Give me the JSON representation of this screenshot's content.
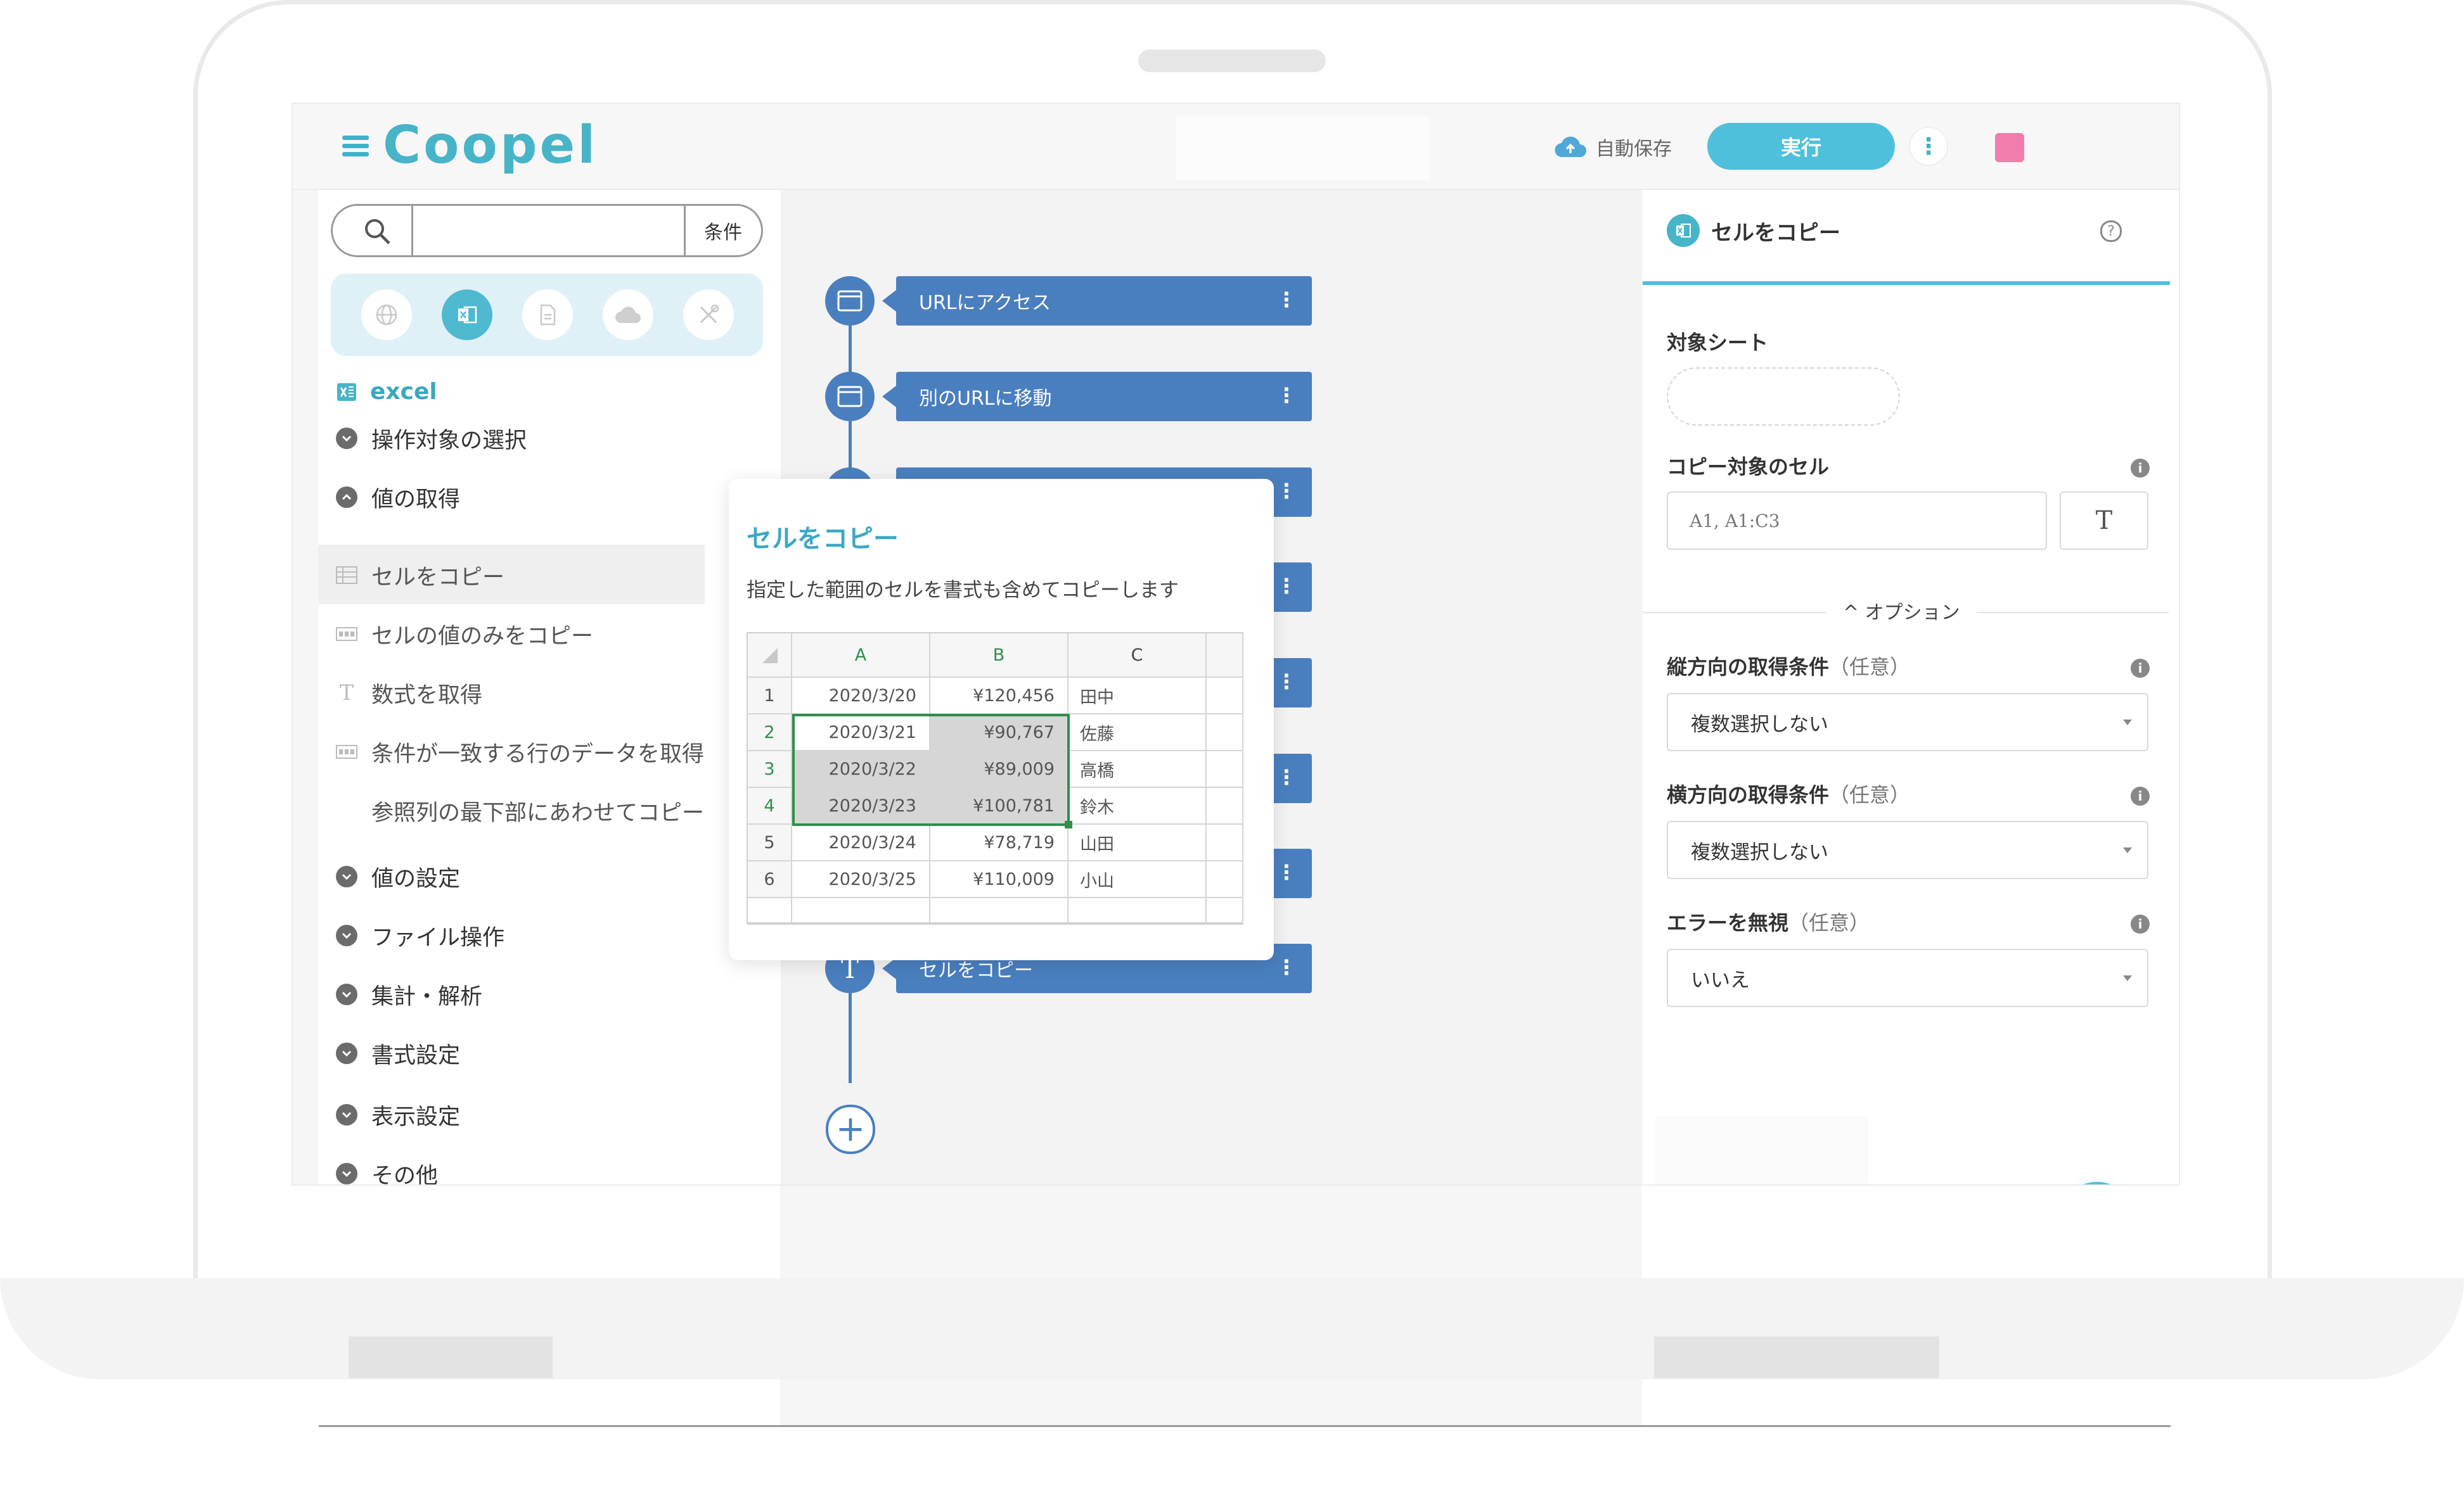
{
  "header": {
    "logo_text": "Coopel",
    "autosave_label": "自動保存",
    "run_label": "実行",
    "more_label": "⋮",
    "avatar_color": "#f07dac",
    "accent_color": "#4fc0dc"
  },
  "sidebar": {
    "search_placeholder": "",
    "filter_label": "条件",
    "categories": [
      {
        "icon": "globe-icon"
      },
      {
        "icon": "excel-icon",
        "active": true
      },
      {
        "icon": "document-icon"
      },
      {
        "icon": "cloud-icon"
      },
      {
        "icon": "tools-icon"
      }
    ],
    "section_title": "excel",
    "groups": [
      {
        "label": "操作対象の選択",
        "state": "collapsed"
      },
      {
        "label": "値の取得",
        "state": "expanded"
      }
    ],
    "items": [
      {
        "label": "セルをコピー",
        "icon": "table-icon",
        "selected": true
      },
      {
        "label": "セルの値のみをコピー",
        "icon": "table-values-icon"
      },
      {
        "label": "数式を取得",
        "icon": "text-t-icon"
      },
      {
        "label": "条件が一致する行のデータを取得",
        "icon": "table-row-icon"
      },
      {
        "label": "参照列の最下部にあわせてコピー",
        "icon": ""
      }
    ],
    "more_groups": [
      {
        "label": "値の設定"
      },
      {
        "label": "ファイル操作"
      },
      {
        "label": "集計・解析"
      },
      {
        "label": "書式設定"
      },
      {
        "label": "表示設定"
      },
      {
        "label": "その他"
      }
    ]
  },
  "flow": {
    "steps": [
      {
        "label": "URLにアクセス",
        "icon": "browser-icon"
      },
      {
        "label": "別のURLに移動",
        "icon": "browser-icon"
      },
      {
        "label": "",
        "icon": ""
      },
      {
        "label": "",
        "icon": ""
      },
      {
        "label": "",
        "icon": ""
      },
      {
        "label": "",
        "icon": ""
      },
      {
        "label": "",
        "icon": ""
      },
      {
        "label": "セルをコピー",
        "icon": "text-t-icon"
      }
    ],
    "kebab": "⋮",
    "add_label": "+"
  },
  "tooltip": {
    "title": "セルをコピー",
    "description": "指定した範囲のセルを書式も含めてコピーします",
    "sheet": {
      "columns": [
        "A",
        "B",
        "C"
      ],
      "rows": [
        {
          "num": "1",
          "a": "2020/3/20",
          "b": "¥120,456",
          "c": "田中"
        },
        {
          "num": "2",
          "a": "2020/3/21",
          "b": "¥90,767",
          "c": "佐藤"
        },
        {
          "num": "3",
          "a": "2020/3/22",
          "b": "¥89,009",
          "c": "高橋"
        },
        {
          "num": "4",
          "a": "2020/3/23",
          "b": "¥100,781",
          "c": "鈴木"
        },
        {
          "num": "5",
          "a": "2020/3/24",
          "b": "¥78,719",
          "c": "山田"
        },
        {
          "num": "6",
          "a": "2020/3/25",
          "b": "¥110,009",
          "c": "小山"
        }
      ],
      "selection_color": "#2f8f4a"
    }
  },
  "panel": {
    "title": "セルをコピー",
    "help": "?",
    "target_sheet_label": "対象シート",
    "target_sheet_value": "",
    "copy_cell_label": "コピー対象のセル",
    "copy_cell_placeholder": "A1, A1:C3",
    "text_type_button": "T",
    "option_label": "^ オプション",
    "vertical_label": "縦方向の取得条件",
    "vertical_optional": "（任意）",
    "vertical_value": "複数選択しない",
    "horizontal_label": "横方向の取得条件",
    "horizontal_optional": "（任意）",
    "horizontal_value": "複数選択しない",
    "ignore_error_label": "エラーを無視",
    "ignore_error_optional": "（任意）",
    "ignore_error_value": "いいえ",
    "info": "i"
  }
}
